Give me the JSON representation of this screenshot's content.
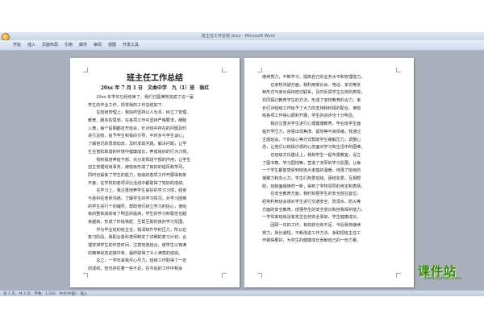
{
  "window": {
    "title": "班主任工作总结.docx - Microsoft Word"
  },
  "ribbon": {
    "tabs": [
      "开始",
      "插入",
      "页面布局",
      "引用",
      "邮件",
      "审阅",
      "视图",
      "开发工具"
    ]
  },
  "document": {
    "title": "班主任工作总结",
    "subtitle": "20xx 年 7 月 1 日　文曲中学　九（1）班　翁红",
    "left_lines": [
      "　　20xx 年学年已经结束了，我们已圆满地完成了这一届",
      "学生的毕业工作。现将我的工作总结如下：",
      "　　在班级管理上，我始终坚持以人为本，树立了管理、",
      "教育、服务的思想，在各项工作中坚持严格要求，细致",
      "入微，每个星期都召开班会，针对班中存在的问题及时",
      "进行总结，给予学生积极的引导。平时多与学生谈心，",
      "了解他们的思想动态，及时发现问题、解决问题，让学",
      "生在宽松和谐的环境中健康成长，养成良好的行为习惯。",
      "　　我积极培养班干部，充分发挥班干部的作用，让学生",
      "自主管理班级事务，使班级形成了良好的班风和学风，",
      "同时也锻炼了学生的能力，班级的各项工作开展得有条",
      "不紊，在学校的各项评比活动中都取得了较好的成绩。",
      "　　在学习上，我注重培养学生良好的学习习惯，经常",
      "与各科任老师沟通，了解学生的学习情况，对学习困难",
      "的学生进行个别辅导，帮助他们树立学习的信心，使班",
      "级的整体成绩有了明显的提高，学生的学习积极性也越",
      "来越高，形成了你追我赶、互帮互助的良好学习氛围。",
      "　　作为毕业班的班主任，我深知升学的压力，所以在",
      "复习阶段，我配合各科老师制定了详细的复习计划，合",
      "理安排学生的作息时间，注意劳逸结合，使学生以饱满",
      "的精神状态迎接中考，最终取得了令人满意的成绩。",
      "　　总之，一学年来我尽心尽力，班级工作取得了一定",
      "的成绩，但也存在着一些不足，在今后的工作中我会"
    ],
    "right_lines": [
      "继续努力，不断学习，提高自己的业务水平和管理能力。",
      "　　在家校沟通方面，我利用家长会、电话、家访等多",
      "种形式与家长保持密切联系，及时反馈学生在校的表现，",
      "共同探讨教育学生的方法，形成了家校教育的合力，家",
      "长们对班级工作给予了大力的支持和积极的配合，使班",
      "级各项工作得以顺利开展，学生的进步也十分明显。",
      "　　我还注重对学生进行心理健康教育，毕业班学生面",
      "临升学压力，容易出现焦虑、紧张等不良情绪，我通过",
      "主题班会、个别谈心等方式帮助学生缓解压力，调整心",
      "态，让他们以积极乐观的心态面对学习和生活中的困难。",
      "　　在班级文化建设上，我和学生一起布置教室，设立",
      "了图书角、学习园地等，营造了浓厚的学习氛围，让每",
      "一个学生都能感受到班级大家庭的温暖，增强了班级的",
      "凝聚力和向心力，学生们热爱班级，团结友爱，互相帮",
      "助，班级面貌焕然一新，得到了学校领导的肯定和表扬。",
      "　　在安全教育方面，我时刻把学生的安全放在首位，",
      "经常利用班会课对学生进行交通安全、防溺水、防火等",
      "方面的安全教育，增强学生的安全意识和自我保护能力，",
      "一学年来班级没有发生任何安全事故，学生健康成长。",
      "　　回顾一年的工作，有收获也有不足，今后我将继续",
      "努力，扬长避短，不断改进工作方法，争取把班主任工",
      "作做得更好，为学生的健康成长贡献自己的一份力量。"
    ]
  },
  "statusbar": {
    "text": "第 1 页，共 2 页　字数：1,560　中文(中国)　插入"
  },
  "watermark": {
    "title": "课件站",
    "url": "www.kjzhan.com"
  },
  "colors": {
    "page": "#ffffff",
    "workspace": "#a9b0bc",
    "watermark": "#3a8a16"
  }
}
